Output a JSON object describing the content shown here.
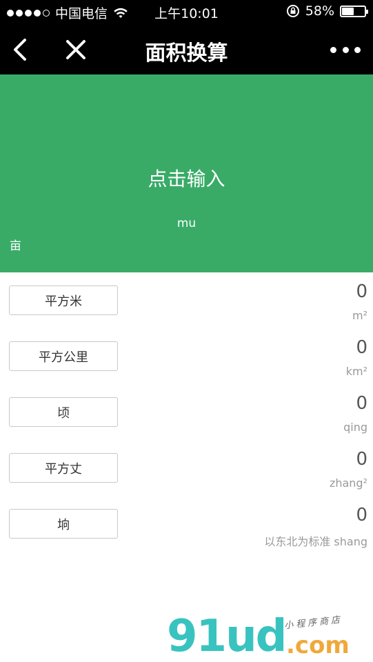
{
  "status_bar": {
    "carrier": "中国电信",
    "time": "上午10:01",
    "battery_percent": "58%",
    "battery_level": 0.58,
    "signal_strength": 4
  },
  "nav": {
    "title": "面积换算"
  },
  "input_panel": {
    "prompt": "点击输入",
    "unit_code": "mu",
    "unit_name": "亩",
    "background": "#39ab67"
  },
  "rows": [
    {
      "label": "平方米",
      "value": "0",
      "unit": "m²"
    },
    {
      "label": "平方公里",
      "value": "0",
      "unit": "km²"
    },
    {
      "label": "顷",
      "value": "0",
      "unit": "qing"
    },
    {
      "label": "平方丈",
      "value": "0",
      "unit": "zhang²"
    },
    {
      "label": "垧",
      "value": "0",
      "unit": "以东北为标准 shang"
    }
  ],
  "watermark": {
    "logo": "91ud",
    "suffix": ".com",
    "tagline": "小程序商店"
  }
}
